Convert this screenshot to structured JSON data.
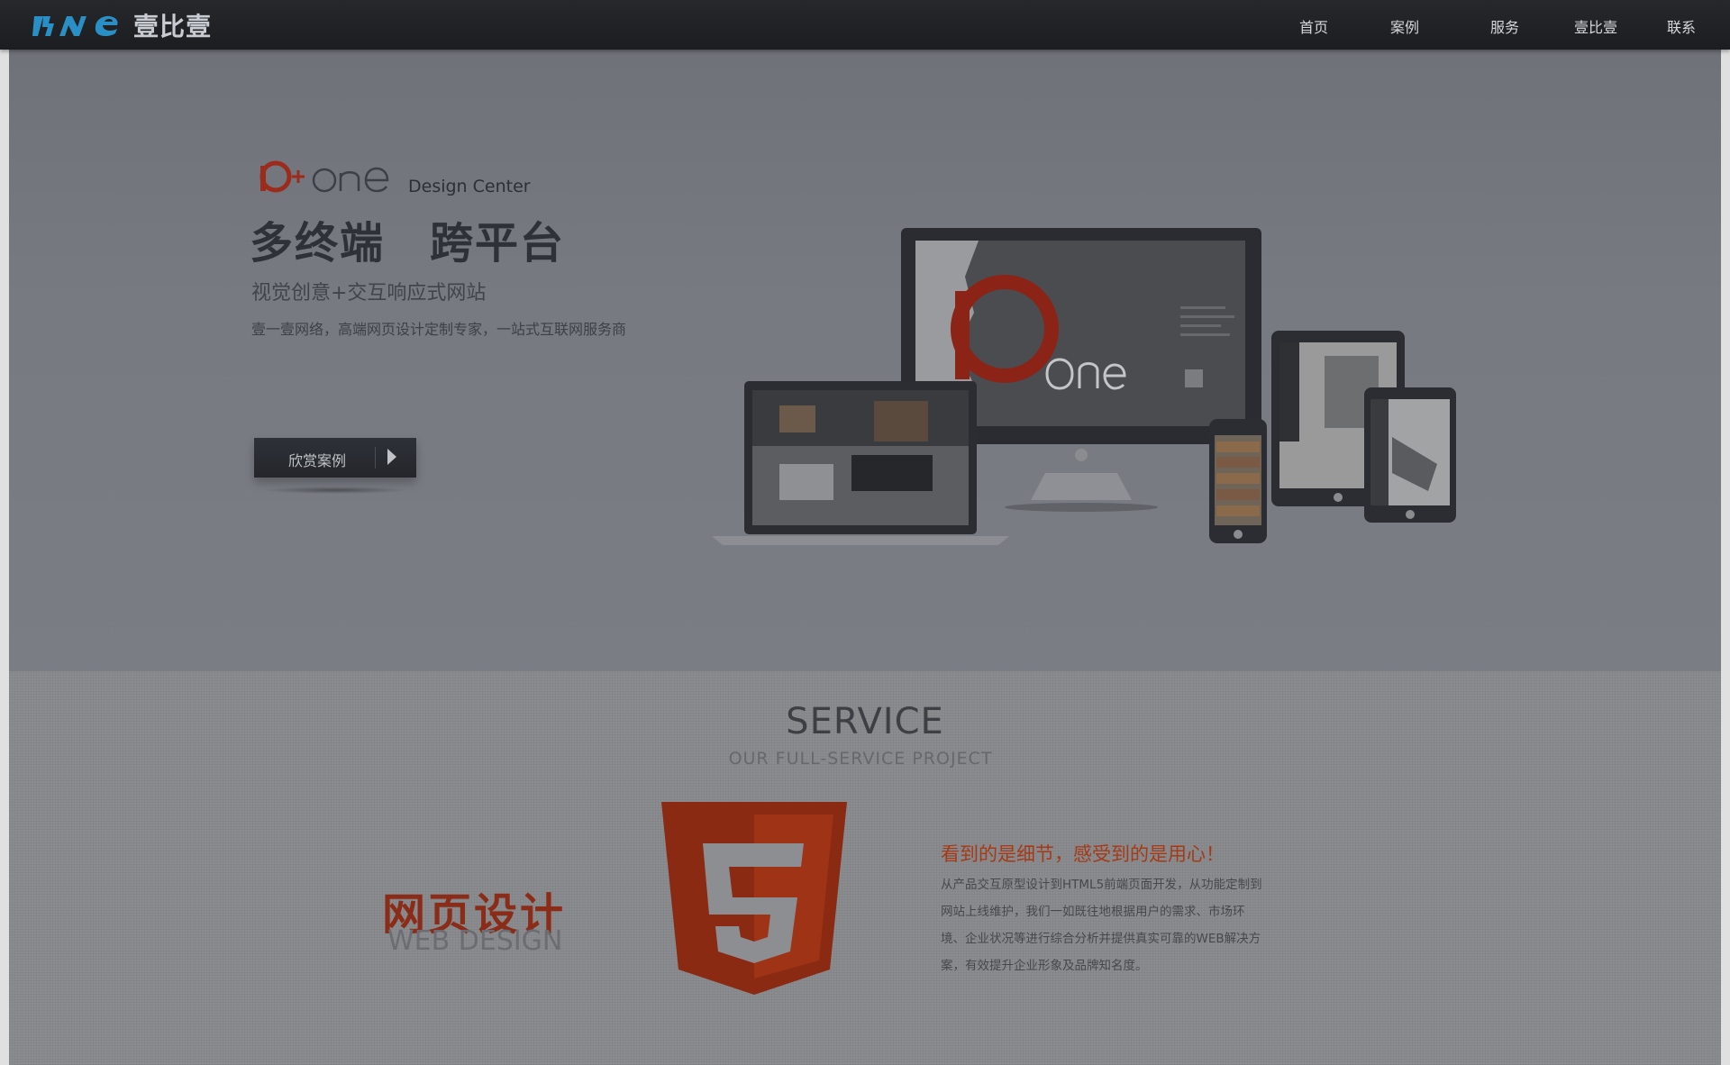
{
  "header": {
    "logo_text": "壹比壹",
    "nav": [
      "首页",
      "案例",
      "服务",
      "壹比壹",
      "联系"
    ]
  },
  "hero": {
    "brand_tagline": "Design Center",
    "title": "多终端　跨平台",
    "subtitle": "视觉创意+交互响应式网站",
    "description": "壹一壹网络，高端网页设计定制专家，一站式互联网服务商",
    "cta_label": "欣赏案例"
  },
  "service": {
    "title": "SERVICE",
    "subtitle": "OUR FULL-SERVICE  PROJECT",
    "category_cn": "网页设计",
    "category_en": "WEB DESIGN",
    "html5_digit": "5",
    "detail_title": "看到的是细节，感受到的是用心！",
    "detail_text": "从产品交互原型设计到HTML5前端页面开发，从功能定制到网站上线维护，我们一如既往地根据用户的需求、市场环境、企业状况等进行综合分析并提供真实可靠的WEB解决方案，有效提升企业形象及品牌知名度。"
  },
  "colors": {
    "topbar": "#1f2024",
    "accent_red": "#a53a17",
    "logo_blue": "#2a8fc4"
  }
}
